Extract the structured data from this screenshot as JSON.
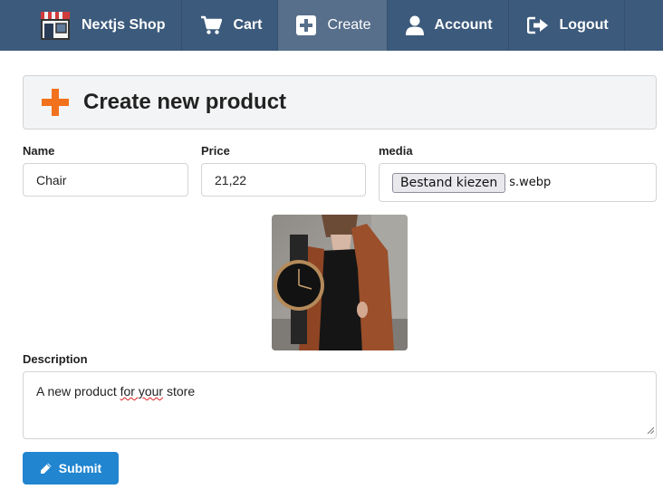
{
  "nav": {
    "brand": "Nextjs Shop",
    "items": [
      {
        "label": "Cart",
        "icon": "cart-icon"
      },
      {
        "label": "Create",
        "icon": "plus-square-icon",
        "active": true
      },
      {
        "label": "Account",
        "icon": "user-icon"
      },
      {
        "label": "Logout",
        "icon": "sign-out-icon"
      }
    ],
    "bg_color": "#3c5a7b",
    "active_color": "#576f8b"
  },
  "header": {
    "title": "Create new product",
    "icon": "plus-icon",
    "icon_color": "#f2711c"
  },
  "form": {
    "name_label": "Name",
    "name_value": "Chair",
    "price_label": "Price",
    "price_value": "21,22",
    "media_label": "media",
    "file_button": "Bestand kiezen",
    "file_name": "s.webp",
    "description_label": "Description",
    "description_before": "A new product ",
    "description_misspelled": "for your",
    "description_after": " store",
    "submit_label": "Submit",
    "submit_color": "#2185d0"
  }
}
